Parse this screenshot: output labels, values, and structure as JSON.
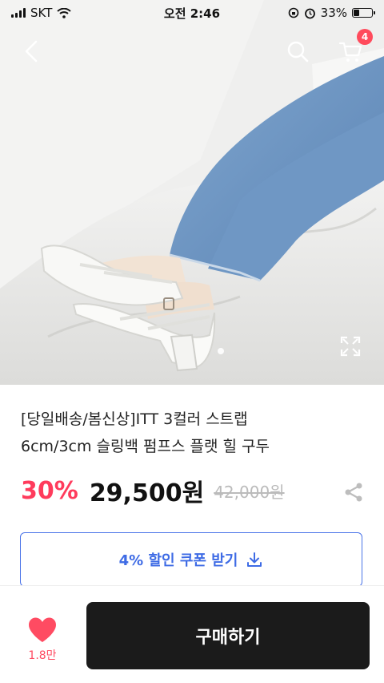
{
  "status_bar": {
    "carrier": "SKT",
    "time": "오전 2:46",
    "battery_percent": "33%",
    "battery_level": 0.33
  },
  "header": {
    "back_icon": "chevron-left-icon",
    "search_icon": "search-icon",
    "cart_icon": "cart-icon",
    "cart_count": "4"
  },
  "gallery": {
    "image_description": "white strap slingback pumps with jeans",
    "pagination_dots": 1,
    "expand_icon": "expand-icon"
  },
  "product": {
    "title_line1": "[당일배송/봄신상]ITT 3컬러 스트랩",
    "title_line2": "6cm/3cm 슬링백 펌프스 플랫 힐 구두",
    "discount": "30%",
    "price": "29,500원",
    "original_price": "42,000원",
    "share_icon": "share-icon"
  },
  "coupon": {
    "label": "4% 할인 쿠폰 받기",
    "icon": "download-icon"
  },
  "bottom_bar": {
    "like_count": "1.8만",
    "buy_label": "구매하기"
  },
  "colors": {
    "accent_red": "#ff3b5c",
    "coupon_blue": "#3e6be5",
    "buy_button": "#1b1b1b",
    "cart_badge": "#ff4b5c"
  }
}
